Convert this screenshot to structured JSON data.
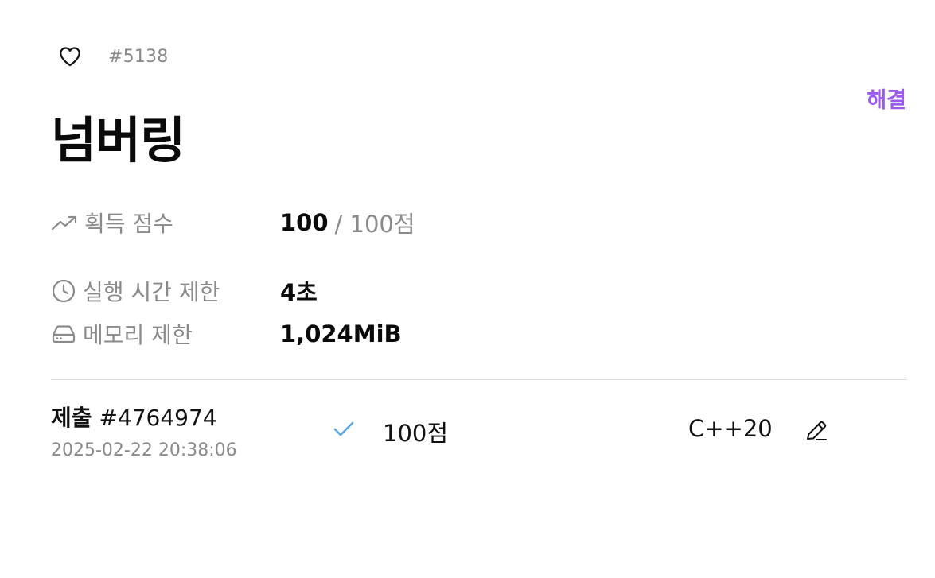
{
  "problem": {
    "id_label": "#5138",
    "title": "넘버링",
    "status": "해결",
    "status_color": "#9b59f0"
  },
  "info": {
    "score_label": "획득 점수",
    "score_value": "100",
    "score_rest": "/ 100점",
    "time_label": "실행 시간 제한",
    "time_value": "4초",
    "memory_label": "메모리 제한",
    "memory_value": "1,024MiB"
  },
  "icons": {
    "like": "heart-outline-icon",
    "score": "trending-up-icon",
    "time": "clock-icon",
    "memory": "hard-drive-icon",
    "result": "check-icon",
    "edit": "pencil-icon"
  },
  "submission": {
    "label": "제출",
    "id": "#4764974",
    "datetime": "2025-02-22 20:38:06",
    "score": "100점",
    "language": "C++20",
    "result_color": "#5aa9e6"
  }
}
